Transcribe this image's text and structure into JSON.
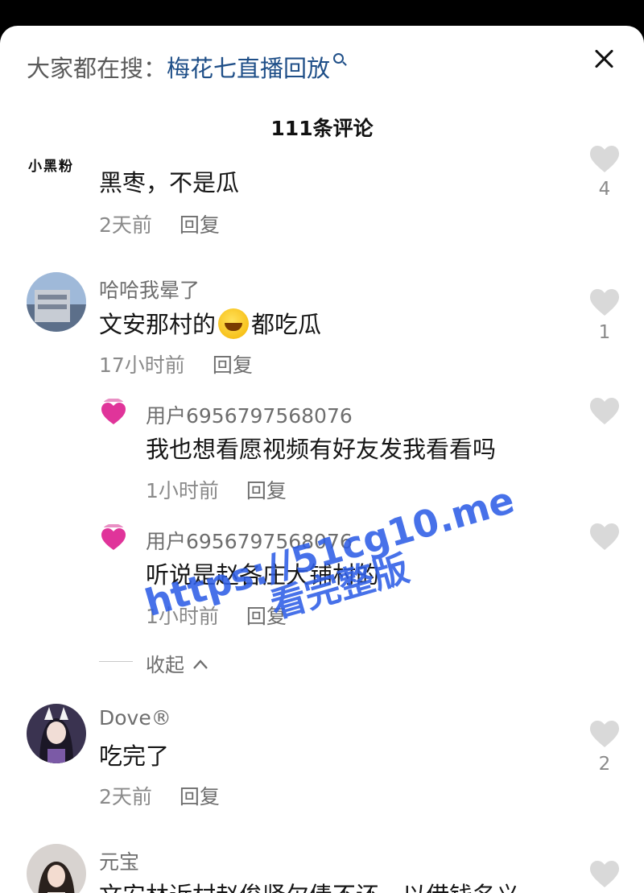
{
  "header": {
    "search_prefix": "大家都在搜：",
    "search_keyword": "梅花七直播回放",
    "comment_count": "111条评论"
  },
  "comments": [
    {
      "user": "小黑粉",
      "text": "黑枣，不是瓜",
      "time": "2天前",
      "reply": "回复",
      "likes": "4"
    },
    {
      "user": "哈哈我晕了",
      "text_before": "文安那村的",
      "text_after": "都吃瓜",
      "time": "17小时前",
      "reply": "回复",
      "likes": "1"
    },
    {
      "user": "用户6956797568076",
      "text": "我也想看愿视频有好友发我看看吗",
      "time": "1小时前",
      "reply": "回复"
    },
    {
      "user": "用户6956797568076",
      "text": "听说是赵各庄大铺村的",
      "time": "1小时前",
      "reply": "回复"
    },
    {
      "user": "Dove®",
      "text": "吃完了",
      "time": "2天前",
      "reply": "回复",
      "likes": "2"
    },
    {
      "user": "元宝",
      "text": "文安林近村赵俊贤欠债不还，以借钱名义"
    }
  ],
  "collapse_label": "收起",
  "watermark": {
    "line1": "https://51cg10.me",
    "line2": "看完整版"
  },
  "colors": {
    "keyword": "#1f4f88",
    "watermark": "#2e5ee6",
    "heart": "#d9d9d9"
  }
}
